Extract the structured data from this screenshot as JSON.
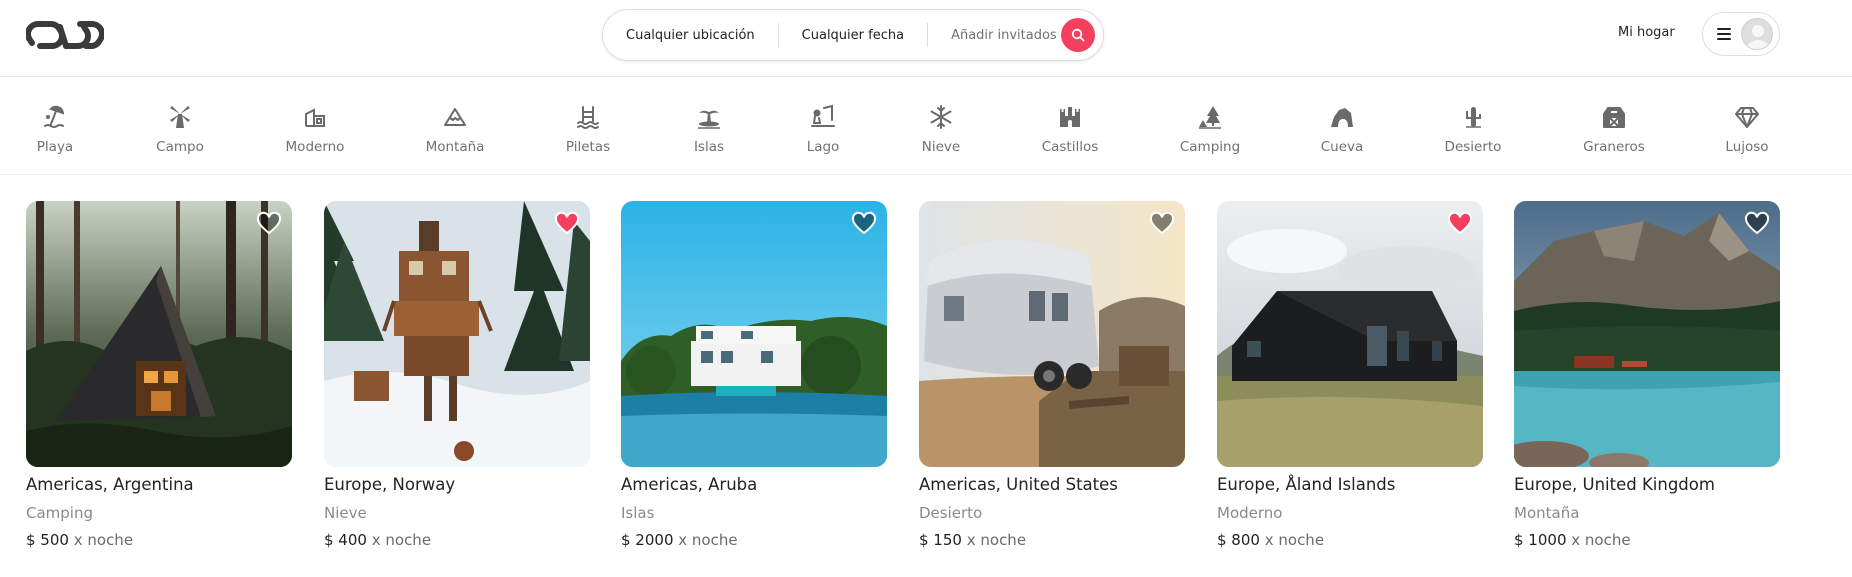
{
  "header": {
    "search": {
      "location": "Cualquier ubicación",
      "date": "Cualquier fecha",
      "guests": "Añadir invitados"
    },
    "host_link": "Mi hogar",
    "icons": [
      "logo-icon",
      "search-icon",
      "menu-icon",
      "avatar-placeholder"
    ]
  },
  "categories": [
    {
      "label": "Playa",
      "icon": "beach-icon"
    },
    {
      "label": "Campo",
      "icon": "windmill-icon"
    },
    {
      "label": "Moderno",
      "icon": "modern-house-icon"
    },
    {
      "label": "Montaña",
      "icon": "mountain-icon"
    },
    {
      "label": "Piletas",
      "icon": "pool-icon"
    },
    {
      "label": "Islas",
      "icon": "island-icon"
    },
    {
      "label": "Lago",
      "icon": "lake-icon"
    },
    {
      "label": "Nieve",
      "icon": "snowflake-icon"
    },
    {
      "label": "Castillos",
      "icon": "castle-icon"
    },
    {
      "label": "Camping",
      "icon": "camping-icon"
    },
    {
      "label": "Cueva",
      "icon": "cave-icon"
    },
    {
      "label": "Desierto",
      "icon": "cactus-icon"
    },
    {
      "label": "Graneros",
      "icon": "barn-icon"
    },
    {
      "label": "Lujoso",
      "icon": "diamond-icon"
    }
  ],
  "listings": [
    {
      "title": "Americas, Argentina",
      "category": "Camping",
      "price": "$ 500",
      "unit": "x noche",
      "favorite": false
    },
    {
      "title": "Europe, Norway",
      "category": "Nieve",
      "price": "$ 400",
      "unit": "x noche",
      "favorite": true
    },
    {
      "title": "Americas, Aruba",
      "category": "Islas",
      "price": "$ 2000",
      "unit": "x noche",
      "favorite": false
    },
    {
      "title": "Americas, United States",
      "category": "Desierto",
      "price": "$ 150",
      "unit": "x noche",
      "favorite": false
    },
    {
      "title": "Europe, Åland Islands",
      "category": "Moderno",
      "price": "$ 800",
      "unit": "x noche",
      "favorite": true
    },
    {
      "title": "Europe, United Kingdom",
      "category": "Montaña",
      "price": "$ 1000",
      "unit": "x noche",
      "favorite": false
    }
  ],
  "colors": {
    "accent": "#f43f5e",
    "favorite": "#f43f5e",
    "heart_outline": "#ffffff",
    "muted_text": "#717171"
  }
}
